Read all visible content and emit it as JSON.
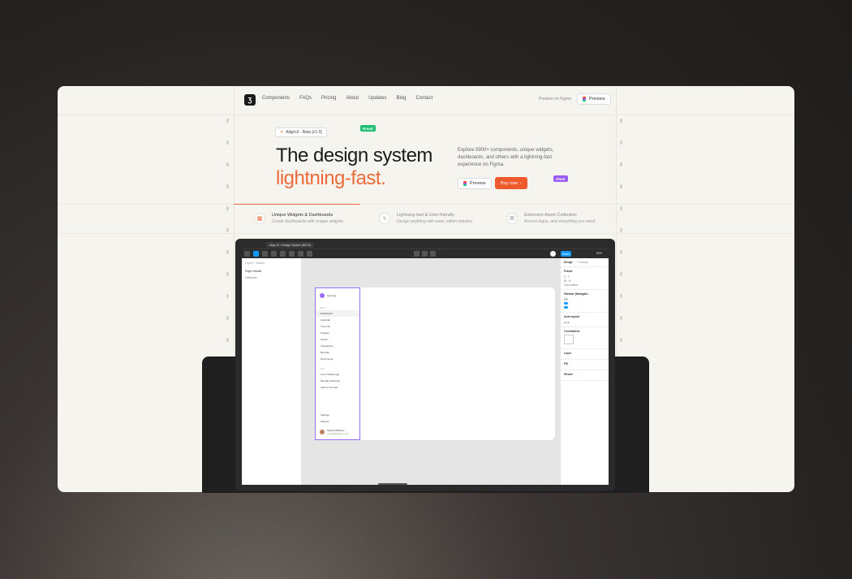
{
  "nav": {
    "items": [
      "Components",
      "FAQs",
      "Pricing",
      "About",
      "Updates",
      "Blog",
      "Contact"
    ],
    "preview_on_figma": "Preview on Figma",
    "preview_button": "Preview"
  },
  "hero": {
    "badge": "AlignUI - Beta [v1.0]",
    "title_line1": "The design system",
    "title_line2": "lightning-fast.",
    "description": "Explore 5900+ components, unique widgets, dashboards, and others with a lightning-fast experience on Figma.",
    "preview_button": "Preview",
    "buy_button": "Buy now",
    "cursor_tags": [
      "Ersad",
      "Omer"
    ]
  },
  "features": [
    {
      "title": "Unique Widgets & Dashboards",
      "subtitle": "Create dashboards with unique widgets."
    },
    {
      "title": "Lightning-fast & User-friendly",
      "subtitle": "Design anything with ease, within minutes."
    },
    {
      "title": "Extensive Asset Collection",
      "subtitle": "Access logos, and everything you need."
    }
  ],
  "colors": {
    "accent": "#ec6a3a",
    "buy": "#ee5a2c",
    "figma_blue": "#0d99ff",
    "tag_green": "#1fbf73",
    "tag_purple": "#9b5cf6"
  },
  "figma_app": {
    "tab": "Align UI • Design System (BETA)",
    "share": "Share",
    "zoom": "80%",
    "left_panel": {
      "pages": [
        "Page Header",
        "Unknown"
      ]
    },
    "mini_sidebar": {
      "app_name": "Synergy",
      "sec_main": "Main",
      "items": [
        "Dashboard",
        "Calendar",
        "Time Off",
        "Projects",
        "Teams",
        "Integrations",
        "Benefits",
        "Documents"
      ],
      "sec_fav": "Favs",
      "favs": [
        "Loom Mobile App",
        "Monday Redesign",
        "Udemy Courses"
      ],
      "bottom": [
        "Settings",
        "Support"
      ],
      "user": "Sophia Williams",
      "email": "sophia@alignui.com"
    },
    "right_panel": {
      "tabs": [
        "Design",
        "Prototype"
      ],
      "sections": [
        "Frame",
        "Sidebar [Navigati...",
        "Auto layout",
        "Constraints",
        "Layer",
        "Fill",
        "Stroke"
      ]
    }
  }
}
